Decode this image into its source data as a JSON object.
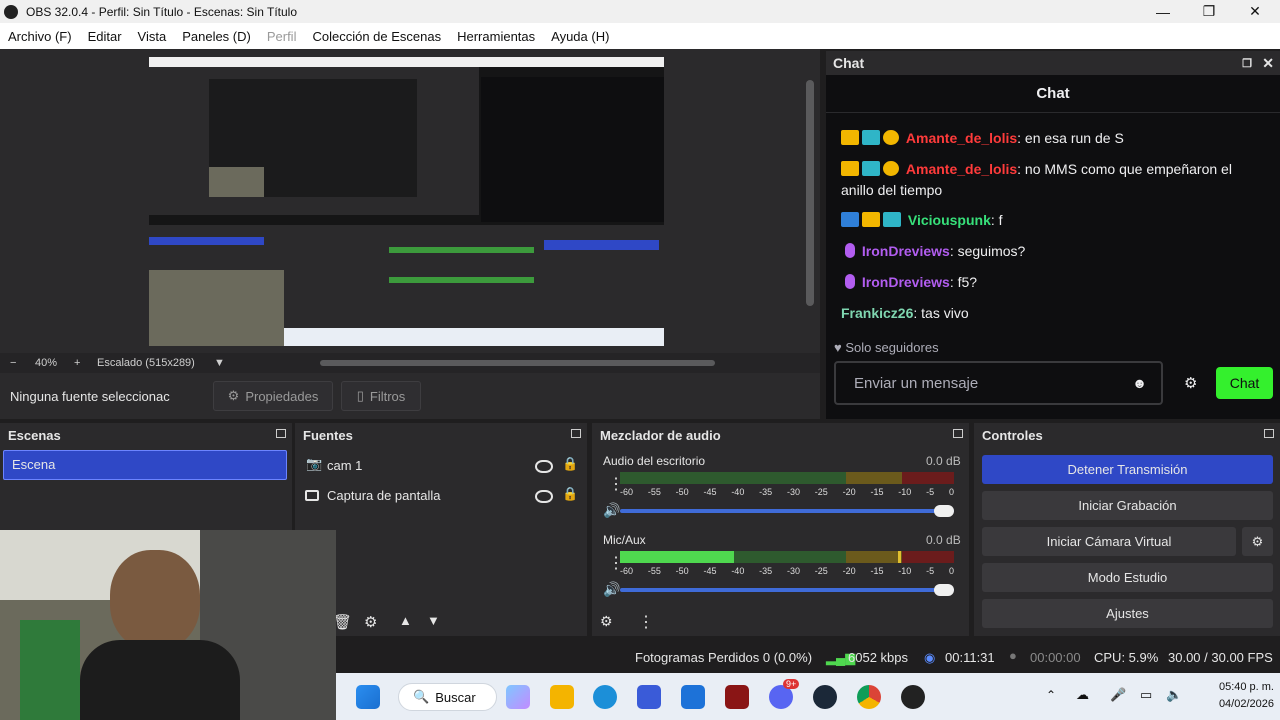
{
  "window": {
    "title": "OBS 32.0.4 - Perfil: Sin Título - Escenas: Sin Título",
    "controls": [
      "—",
      "❐",
      "✕"
    ]
  },
  "menu": [
    "Archivo (F)",
    "Editar",
    "Vista",
    "Paneles (D)",
    "Perfil",
    "Colección de Escenas",
    "Herramientas",
    "Ayuda (H)"
  ],
  "preview": {
    "zoom_minus": "−",
    "zoom": "40%",
    "zoom_plus": "+",
    "scale": "Escalado (515x289)"
  },
  "source_bar": {
    "no_source": "Ninguna fuente seleccionac",
    "properties": "Propiedades",
    "filters": "Filtros"
  },
  "chat": {
    "dock_title": "Chat",
    "header": "Chat",
    "messages": [
      {
        "user": "Amante_de_lolis",
        "color": "#ff3b3b",
        "sep": ":",
        "text": " en esa run de S"
      },
      {
        "user": "Amante_de_lolis",
        "color": "#ff3b3b",
        "sep": ":",
        "text": " no MMS como que empeñaron el anillo del tiempo"
      },
      {
        "user": "Viciouspunk",
        "color": "#37e07a",
        "sep": ":",
        "text": " f"
      },
      {
        "user": "IronDreviews",
        "color": "#b25df0",
        "sep": ":",
        "text": " seguimos?"
      },
      {
        "user": "IronDreviews",
        "color": "#b25df0",
        "sep": ":",
        "text": " f5?"
      },
      {
        "user": "Frankicz26",
        "color": "#7fd6b0",
        "sep": ":",
        "text": " tas vivo"
      }
    ],
    "followers_only": "Solo seguidores",
    "placeholder": "Enviar un mensaje",
    "send": "Chat"
  },
  "scenes": {
    "title": "Escenas",
    "items": [
      "Escena"
    ]
  },
  "sources": {
    "title": "Fuentes",
    "items": [
      "cam 1",
      "Captura de pantalla"
    ]
  },
  "mixer": {
    "title": "Mezclador de audio",
    "tracks": [
      {
        "name": "Audio del escritorio",
        "db": "0.0 dB",
        "level": 0.0
      },
      {
        "name": "Mic/Aux",
        "db": "0.0 dB",
        "level": 0.34
      }
    ],
    "ticks": [
      "-60",
      "-55",
      "-50",
      "-45",
      "-40",
      "-35",
      "-30",
      "-25",
      "-20",
      "-15",
      "-10",
      "-5",
      "0"
    ]
  },
  "controls": {
    "title": "Controles",
    "stop_stream": "Detener Transmisión",
    "start_record": "Iniciar Grabación",
    "virtual_cam": "Iniciar Cámara Virtual",
    "studio": "Modo Estudio",
    "settings": "Ajustes"
  },
  "status": {
    "dropped": "Fotogramas Perdidos 0 (0.0%)",
    "bitrate": "6052 kbps",
    "stream_time": "00:11:31",
    "rec_time": "00:00:00",
    "cpu": "CPU: 5.9%",
    "fps": "30.00 / 30.00 FPS"
  },
  "taskbar": {
    "search": "Buscar",
    "time": "05:40 p. m.",
    "date": "04/02/2026",
    "badge": "9+"
  },
  "colors": {
    "accent": "#2f48c6",
    "twitch_green": "#34f02d",
    "obs_bg": "#2b2a2c"
  }
}
